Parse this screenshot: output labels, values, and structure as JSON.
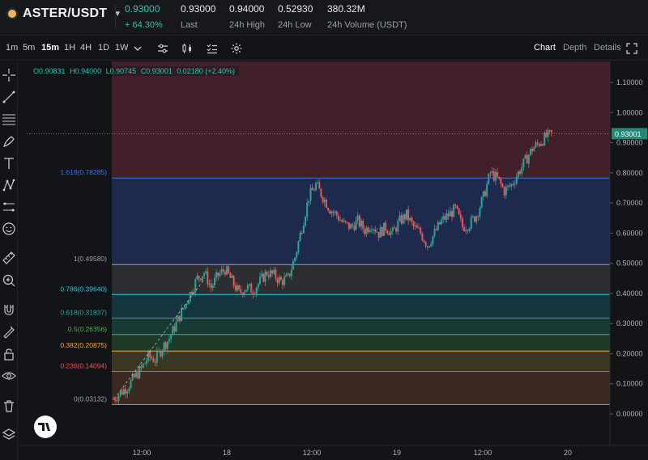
{
  "header": {
    "pair": "ASTER/USDT",
    "price": "0.93000",
    "change": "+ 64.30%",
    "stats": [
      {
        "value": "0.93000",
        "label": "Last"
      },
      {
        "value": "0.94000",
        "label": "24h High"
      },
      {
        "value": "0.52930",
        "label": "24h Low"
      },
      {
        "value": "380.32M",
        "label": "24h Volume (USDT)"
      }
    ]
  },
  "toolbar": {
    "timeframes": [
      "1m",
      "5m",
      "15m",
      "1H",
      "4H",
      "1D",
      "1W"
    ],
    "active_timeframe": "15m",
    "tabs": [
      "Chart",
      "Depth",
      "Details"
    ],
    "active_tab": "Chart"
  },
  "ohlc": {
    "open": "O0.90831",
    "high": "H0.94000",
    "low": "L0.90745",
    "close": "C0.93001",
    "change": "0.02180 (+2.40%)"
  },
  "colors": {
    "up": "#26a69a",
    "down": "#ef5350",
    "accent": "#26c6b0"
  },
  "chart_data": {
    "type": "candlestick",
    "y_ticks": [
      "1.10000",
      "1.00000",
      "0.90000",
      "0.80000",
      "0.70000",
      "0.60000",
      "0.50000",
      "0.40000",
      "0.30000",
      "0.20000",
      "0.10000",
      "0.00000"
    ],
    "x_ticks": [
      "12:00",
      "18",
      "12:00",
      "19",
      "12:00",
      "20"
    ],
    "current_price_label": "0.93001",
    "current_price": 0.93001,
    "fib_levels": [
      {
        "label": "1.618(0.78285)",
        "value": 0.78285,
        "color": "#3d6fe0"
      },
      {
        "label": "1(0.49580)",
        "value": 0.4958,
        "color": "#9aa0a8"
      },
      {
        "label": "0.786(0.39640)",
        "value": 0.3964,
        "color": "#26c6da"
      },
      {
        "label": "0.618(0.31837)",
        "value": 0.31837,
        "color": "#26a69a"
      },
      {
        "label": "0.5(0.26356)",
        "value": 0.26356,
        "color": "#4caf50"
      },
      {
        "label": "0.382(0.20875)",
        "value": 0.20875,
        "color": "#ffa726"
      },
      {
        "label": "0.236(0.14094)",
        "value": 0.14094,
        "color": "#ef5350"
      },
      {
        "label": "0(0.03132)",
        "value": 0.03132,
        "color": "#9aa0a8"
      }
    ],
    "price_path": [
      0.05,
      0.07,
      0.09,
      0.12,
      0.15,
      0.19,
      0.18,
      0.22,
      0.25,
      0.3,
      0.35,
      0.4,
      0.45,
      0.47,
      0.42,
      0.46,
      0.48,
      0.44,
      0.4,
      0.42,
      0.41,
      0.44,
      0.47,
      0.46,
      0.44,
      0.45,
      0.52,
      0.62,
      0.72,
      0.76,
      0.72,
      0.68,
      0.66,
      0.63,
      0.62,
      0.64,
      0.61,
      0.63,
      0.6,
      0.62,
      0.6,
      0.64,
      0.66,
      0.62,
      0.6,
      0.56,
      0.6,
      0.64,
      0.66,
      0.68,
      0.62,
      0.63,
      0.66,
      0.72,
      0.8,
      0.78,
      0.74,
      0.76,
      0.8,
      0.84,
      0.88,
      0.9,
      0.92,
      0.93
    ]
  }
}
